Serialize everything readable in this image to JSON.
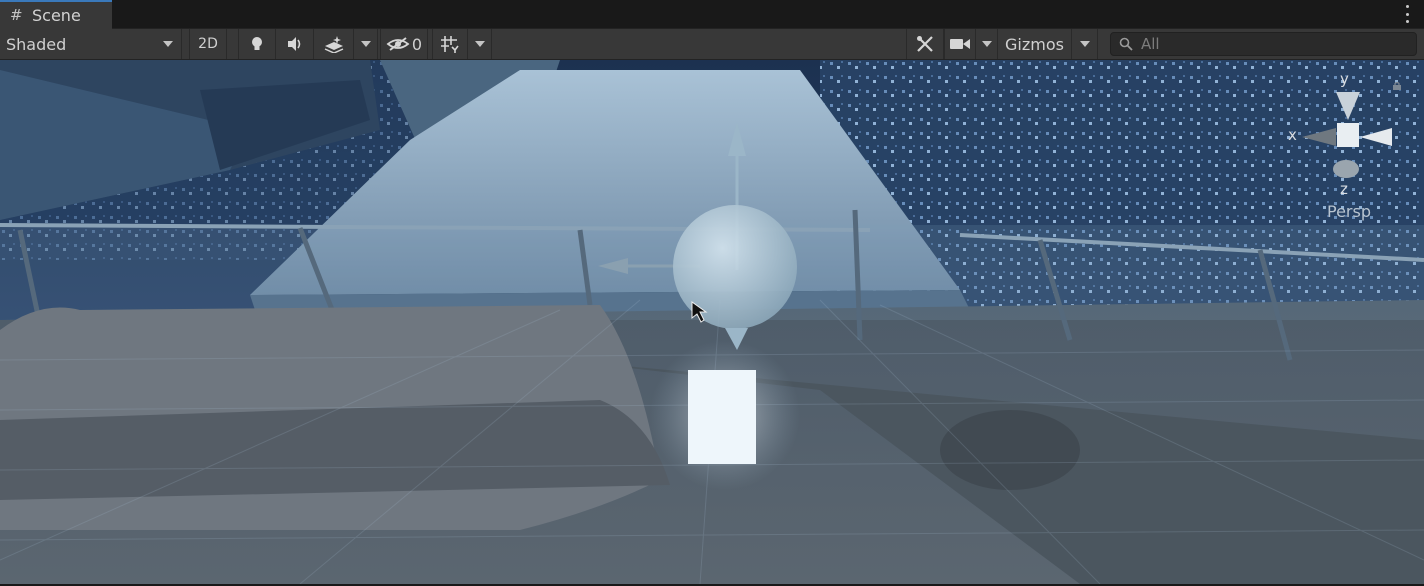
{
  "tab": {
    "title": "Scene",
    "icon": "scene-grid-icon"
  },
  "toolbar": {
    "draw_mode": "Shaded",
    "toggle_2d": "2D",
    "hidden_count": "0",
    "gizmos_label": "Gizmos",
    "search_placeholder": "All"
  },
  "icons": {
    "lighting": "light-bulb-icon",
    "audio": "audio-icon",
    "effects": "effects-icon",
    "visibility": "hidden-eye-icon",
    "grid": "grid-snap-icon",
    "tools": "tools-icon",
    "camera": "camera-icon",
    "search": "search-icon",
    "lock": "lock-icon"
  },
  "orientation_gizmo": {
    "axis_y": "y",
    "axis_x": "x",
    "axis_z": "z",
    "projection": "Persp"
  },
  "colors": {
    "accent": "#3a79bb",
    "toolbar_bg": "#383838",
    "panel_bg": "#191919"
  }
}
